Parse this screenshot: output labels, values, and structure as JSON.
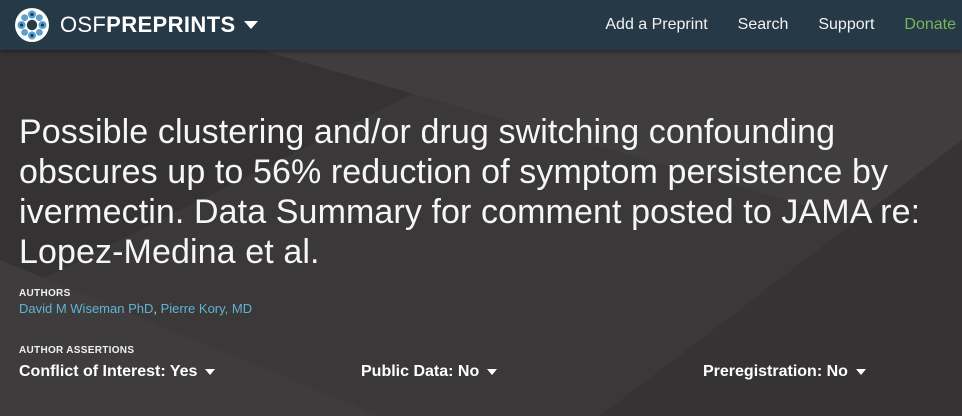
{
  "navbar": {
    "brand_osf": "OSF",
    "brand_product": "PREPRINTS",
    "links": {
      "add_preprint": "Add a Preprint",
      "search": "Search",
      "support": "Support",
      "donate": "Donate"
    }
  },
  "preprint": {
    "title": "Possible clustering and/or drug switching confounding obscures up to 56% reduction of symptom persistence by ivermectin. Data Summary for comment posted to JAMA re: Lopez-Medina et al.",
    "authors_label": "AUTHORS",
    "authors": [
      "David M Wiseman PhD",
      "Pierre Kory, MD"
    ],
    "author_separator": ", ",
    "assertions_label": "AUTHOR ASSERTIONS",
    "assertions": {
      "conflict_of_interest": "Conflict of Interest: Yes",
      "public_data": "Public Data: No",
      "preregistration": "Preregistration: No"
    }
  },
  "colors": {
    "navbar_bg": "#263947",
    "header_bg": "#3a3838",
    "link": "#5fb4d6",
    "donate": "#7ab55c",
    "logo_petal": "#5ba0d0"
  },
  "icons": {
    "brand_logo": "osf-flower-logo",
    "brand_caret": "caret-down-icon",
    "assertion_caret": "caret-down-icon"
  }
}
